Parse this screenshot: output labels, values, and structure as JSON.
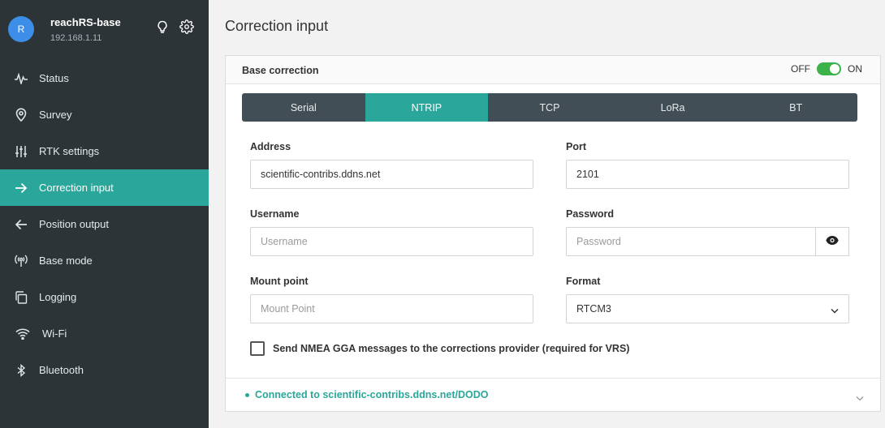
{
  "device": {
    "avatar_letter": "R",
    "name": "reachRS-base",
    "ip": "192.168.1.11",
    "icons": [
      "lightbulb-icon",
      "gear-icon"
    ]
  },
  "nav": {
    "items": [
      {
        "label": "Status",
        "icon": "activity-icon"
      },
      {
        "label": "Survey",
        "icon": "map-pin-icon"
      },
      {
        "label": "RTK settings",
        "icon": "sliders-icon"
      },
      {
        "label": "Correction input",
        "icon": "arrow-right-icon",
        "active": true
      },
      {
        "label": "Position output",
        "icon": "arrow-left-icon"
      },
      {
        "label": "Base mode",
        "icon": "antenna-icon"
      },
      {
        "label": "Logging",
        "icon": "copy-icon"
      },
      {
        "label": "Wi-Fi",
        "icon": "wifi-icon"
      },
      {
        "label": "Bluetooth",
        "icon": "bluetooth-icon"
      }
    ]
  },
  "page": {
    "title": "Correction input"
  },
  "card": {
    "title": "Base correction",
    "toggle": {
      "off_label": "OFF",
      "on_label": "ON",
      "state": "on"
    },
    "tabs": [
      {
        "label": "Serial"
      },
      {
        "label": "NTRIP",
        "active": true
      },
      {
        "label": "TCP"
      },
      {
        "label": "LoRa"
      },
      {
        "label": "BT"
      }
    ],
    "fields": {
      "address": {
        "label": "Address",
        "value": "scientific-contribs.ddns.net"
      },
      "port": {
        "label": "Port",
        "value": "2101"
      },
      "username": {
        "label": "Username",
        "placeholder": "Username"
      },
      "password": {
        "label": "Password",
        "placeholder": "Password"
      },
      "mount_point": {
        "label": "Mount point",
        "placeholder": "Mount Point"
      },
      "format": {
        "label": "Format",
        "value": "RTCM3"
      }
    },
    "nmea_checkbox": {
      "label": "Send NMEA GGA messages to the corrections provider (required for VRS)",
      "checked": false
    },
    "status": "Connected to scientific-contribs.ddns.net/DODO"
  },
  "colors": {
    "sidebar_bg": "#2c3438",
    "accent": "#2aa79a",
    "tabs_bg": "#424e55",
    "toggle_on": "#3bb34a",
    "avatar": "#3d8ee8"
  }
}
